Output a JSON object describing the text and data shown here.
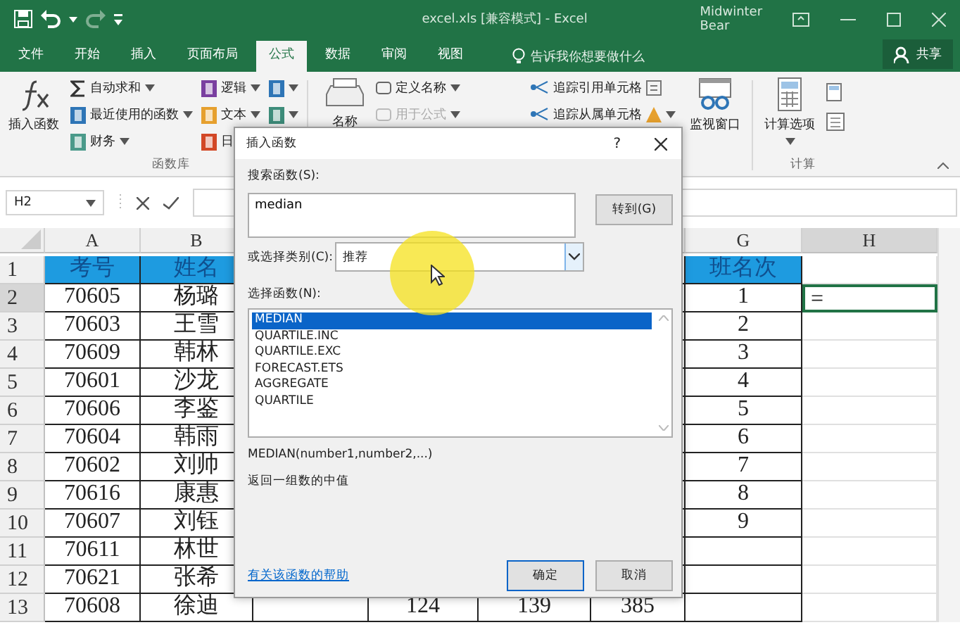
{
  "window": {
    "title": "excel.xls [兼容模式] - Excel",
    "user": "Midwinter Bear"
  },
  "tabs": [
    {
      "label": "文件",
      "selected": false
    },
    {
      "label": "开始",
      "selected": false
    },
    {
      "label": "插入",
      "selected": false
    },
    {
      "label": "页面布局",
      "selected": false
    },
    {
      "label": "公式",
      "selected": true
    },
    {
      "label": "数据",
      "selected": false
    },
    {
      "label": "审阅",
      "selected": false
    },
    {
      "label": "视图",
      "selected": false
    }
  ],
  "tell_me": "告诉我你想要做什么",
  "share": "共享",
  "ribbon": {
    "insert_function": "插入函数",
    "library_columns": [
      [
        "自动求和",
        "最近使用的函数",
        "财务"
      ],
      [
        "逻辑",
        "文本",
        "日"
      ]
    ],
    "library_label": "函数库",
    "names_big": "名称",
    "names": [
      {
        "label": "定义名称",
        "disabled": false
      },
      {
        "label": "用于公式",
        "disabled": true
      }
    ],
    "auditing": [
      "追踪引用单元格",
      "追踪从属单元格"
    ],
    "watch": "监视窗口",
    "calc_options": "计算选项",
    "calc_label": "计算"
  },
  "name_box": "H2",
  "sheet": {
    "columns": [
      {
        "label": "A",
        "selected": false
      },
      {
        "label": "B",
        "selected": false
      },
      {
        "label": "G",
        "selected": false
      },
      {
        "label": "H",
        "selected": true
      }
    ],
    "rows": [
      {
        "number": "1",
        "kind": "header",
        "selected": false,
        "a": "考号",
        "b": "姓名",
        "g": "班名次"
      },
      {
        "number": "2",
        "kind": "data",
        "selected": true,
        "a": "70605",
        "b": "杨璐",
        "g": "1",
        "h": "="
      },
      {
        "number": "3",
        "kind": "data",
        "selected": false,
        "a": "70603",
        "b": "王雪",
        "g": "2"
      },
      {
        "number": "4",
        "kind": "data",
        "selected": false,
        "a": "70609",
        "b": "韩林",
        "g": "3"
      },
      {
        "number": "5",
        "kind": "data",
        "selected": false,
        "a": "70601",
        "b": "沙龙",
        "g": "4"
      },
      {
        "number": "6",
        "kind": "data",
        "selected": false,
        "a": "70606",
        "b": "李鉴",
        "g": "5"
      },
      {
        "number": "7",
        "kind": "data",
        "selected": false,
        "a": "70604",
        "b": "韩雨",
        "g": "6"
      },
      {
        "number": "8",
        "kind": "data",
        "selected": false,
        "a": "70602",
        "b": "刘帅",
        "g": "7"
      },
      {
        "number": "9",
        "kind": "data",
        "selected": false,
        "a": "70616",
        "b": "康惠",
        "g": "8"
      },
      {
        "number": "10",
        "kind": "data",
        "selected": false,
        "a": "70607",
        "b": "刘钰",
        "g": "9"
      },
      {
        "number": "11",
        "kind": "data",
        "selected": false,
        "a": "70611",
        "b": "林世"
      },
      {
        "number": "12",
        "kind": "data",
        "selected": false,
        "a": "70621",
        "b": "张希"
      },
      {
        "number": "13",
        "kind": "data",
        "selected": false,
        "a": "70608",
        "b": "徐迪",
        "d": "124",
        "e": "139",
        "f": "385"
      }
    ]
  },
  "dialog": {
    "title": "插入函数",
    "help": "?",
    "search_label": "搜索函数(S):",
    "search_value": "median",
    "go": "转到(G)",
    "category_label": "或选择类别(C):",
    "category": "推荐",
    "select_label": "选择函数(N):",
    "functions": [
      {
        "name": "MEDIAN",
        "selected": true
      },
      {
        "name": "QUARTILE.INC",
        "selected": false
      },
      {
        "name": "QUARTILE.EXC",
        "selected": false
      },
      {
        "name": "FORECAST.ETS",
        "selected": false
      },
      {
        "name": "AGGREGATE",
        "selected": false
      },
      {
        "name": "QUARTILE",
        "selected": false
      }
    ],
    "syntax": "MEDIAN(number1,number2,...)",
    "description": "返回一组数的中值",
    "help_link": "有关该函数的帮助",
    "ok": "确定",
    "cancel": "取消"
  }
}
